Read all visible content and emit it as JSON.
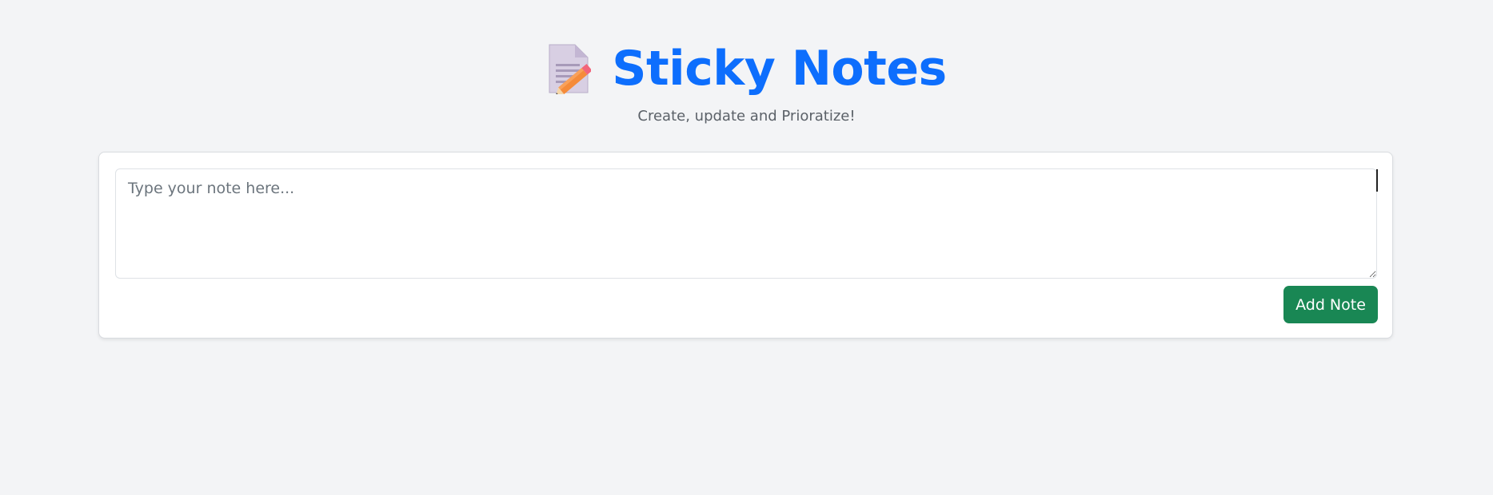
{
  "header": {
    "icon": "memo-icon",
    "title": "Sticky Notes",
    "subtitle": "Create, update and Prioratize!"
  },
  "note_form": {
    "textarea_value": "",
    "textarea_placeholder": "Type your note here...",
    "add_button_label": "Add Note"
  },
  "colors": {
    "title": "#0d6efd",
    "button": "#198754",
    "background": "#f3f4f6"
  }
}
